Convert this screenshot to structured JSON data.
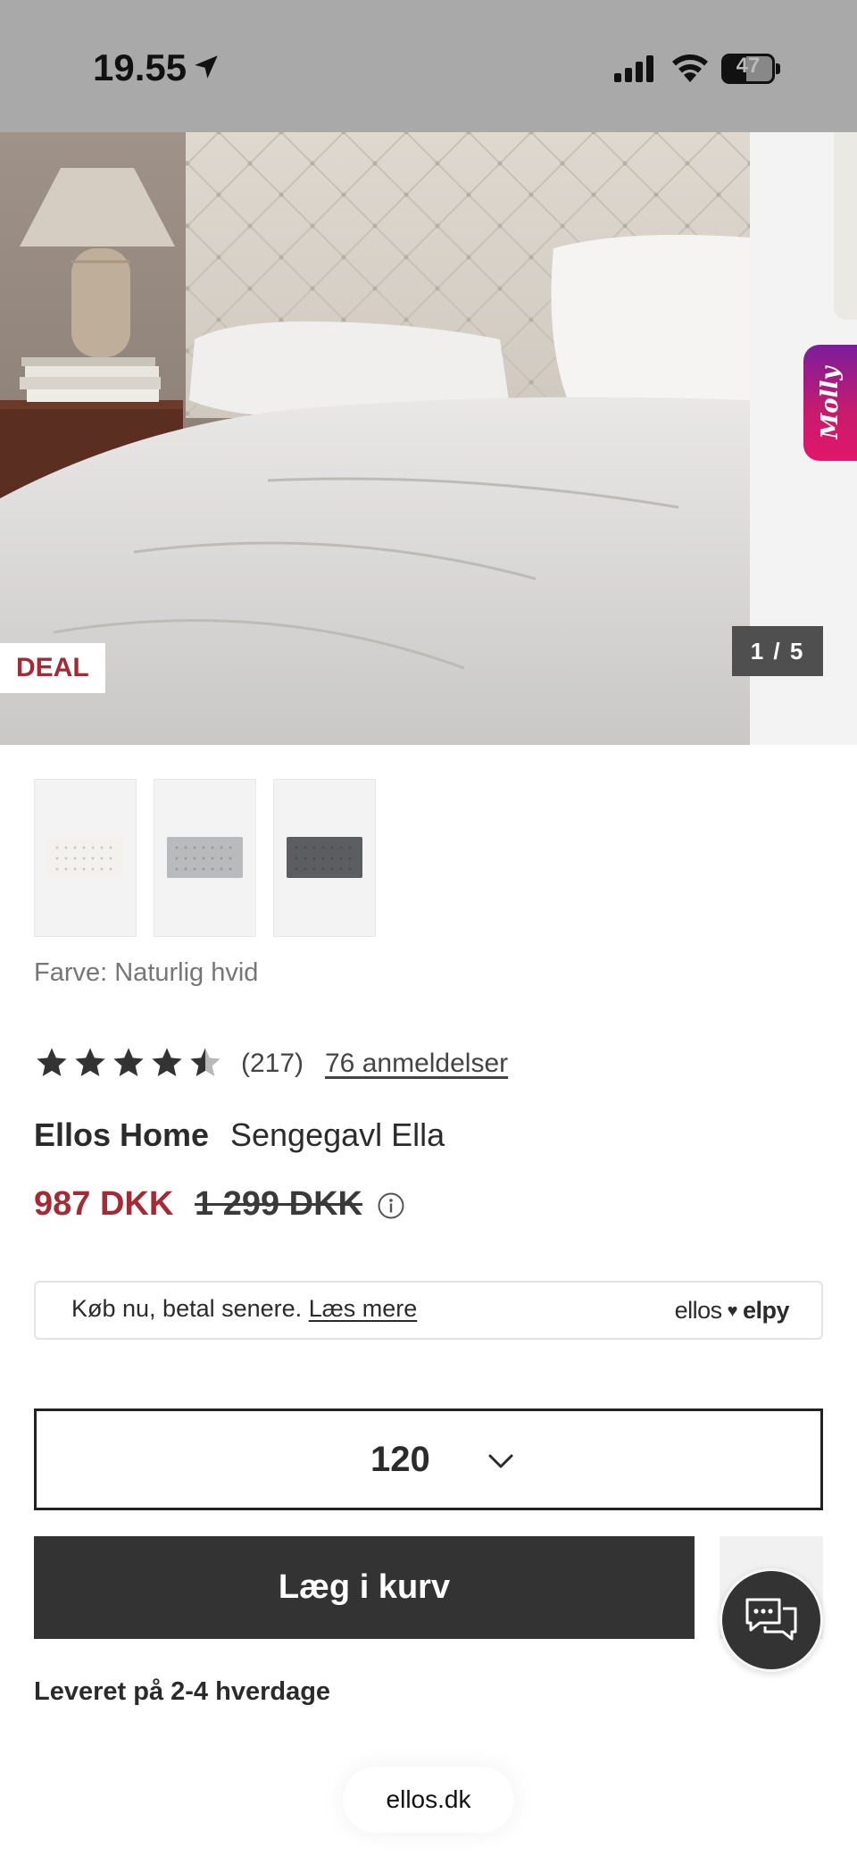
{
  "status_bar": {
    "time": "19.55",
    "battery": "47",
    "battery_level": 0.47
  },
  "gallery": {
    "badge": "DEAL",
    "counter": "1 / 5",
    "assistant_label": "Molly"
  },
  "color_variants": [
    {
      "name": "thumb-white",
      "color": "#f2f1ed"
    },
    {
      "name": "thumb-lightgrey",
      "color": "#b9babb"
    },
    {
      "name": "thumb-darkgrey",
      "color": "#5b5d60"
    }
  ],
  "color_label": "Farve: Naturlig hvid",
  "rating": {
    "stars": 4.5,
    "count": "(217)",
    "reviews_link": "76 anmeldelser"
  },
  "product": {
    "brand": "Ellos Home",
    "name": "Sengegavl Ella",
    "price": "987 DKK",
    "old_price": "1 299 DKK"
  },
  "pay_later": {
    "text": "Køb nu, betal senere.",
    "link": "Læs mere",
    "logo_left": "ellos",
    "logo_right": "elpy"
  },
  "size": {
    "value": "120"
  },
  "actions": {
    "add_to_cart": "Læg i kurv"
  },
  "delivery": "Leveret på 2-4 hverdage",
  "browser": {
    "url": "ellos.dk"
  },
  "colors": {
    "accent_red": "#a42b36",
    "button_dark": "#333333",
    "status_bar_bg": "#a9a9a9"
  }
}
